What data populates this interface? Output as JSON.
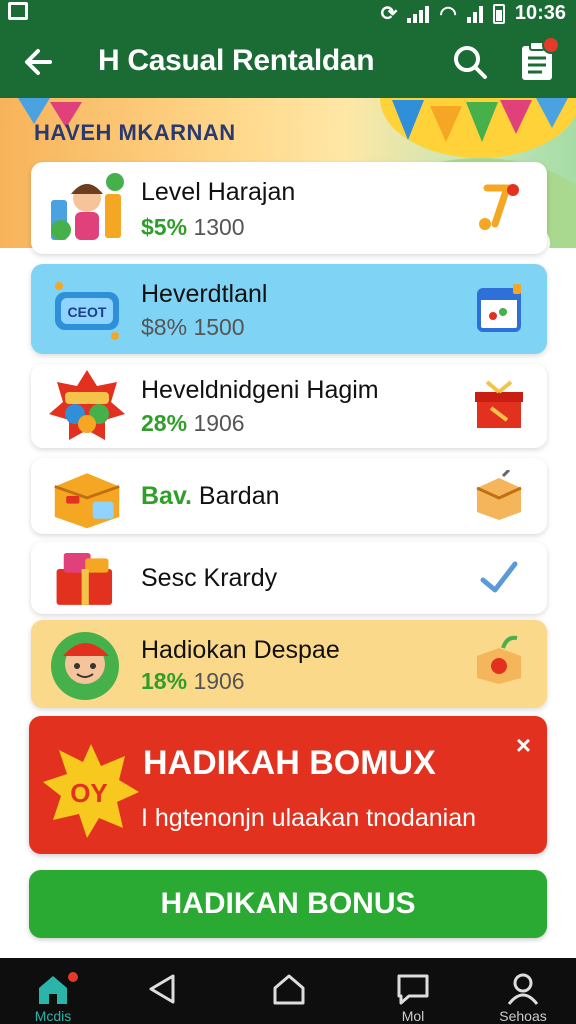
{
  "status_bar": {
    "time": "10:36"
  },
  "app_bar": {
    "title": "H Casual Rentaldan"
  },
  "banner": {
    "heading": "HAVEH MKARNAN"
  },
  "cards": [
    {
      "name": "Level Harajan",
      "pct": "$5%",
      "price": "1300",
      "bg": "#ffffff"
    },
    {
      "name": "Heverdtlanl",
      "pct": "$8%",
      "price": "1500",
      "bg": "#7fd3f5"
    },
    {
      "name": "Heveldnidgeni Hagim",
      "pct": "28%",
      "price": "1906",
      "bg": "#ffffff"
    },
    {
      "name_prefix": "Bav.",
      "name": "Bardan",
      "bg": "#ffffff"
    },
    {
      "name": "Sesc Krardy",
      "bg": "#ffffff"
    },
    {
      "name": "Hadiokan Despae",
      "pct": "18%",
      "price": "1906",
      "bg": "#fbd98a"
    }
  ],
  "promo": {
    "title": "HADIKAH BOMUX",
    "subtitle": "I hgtenonjn ulaakan tnodanian",
    "burst_text": "OY",
    "close_label": "×"
  },
  "cta": {
    "label": "HADIKAN BONUS"
  },
  "nav": [
    {
      "label": "Mcdis"
    },
    {
      "label": ""
    },
    {
      "label": ""
    },
    {
      "label": "Mol"
    },
    {
      "label": "Sehoas"
    }
  ],
  "colors": {
    "app_bar": "#1b6b35",
    "promo": "#e2321f",
    "cta": "#2aaa33",
    "price_accent": "#2f9e2a"
  }
}
